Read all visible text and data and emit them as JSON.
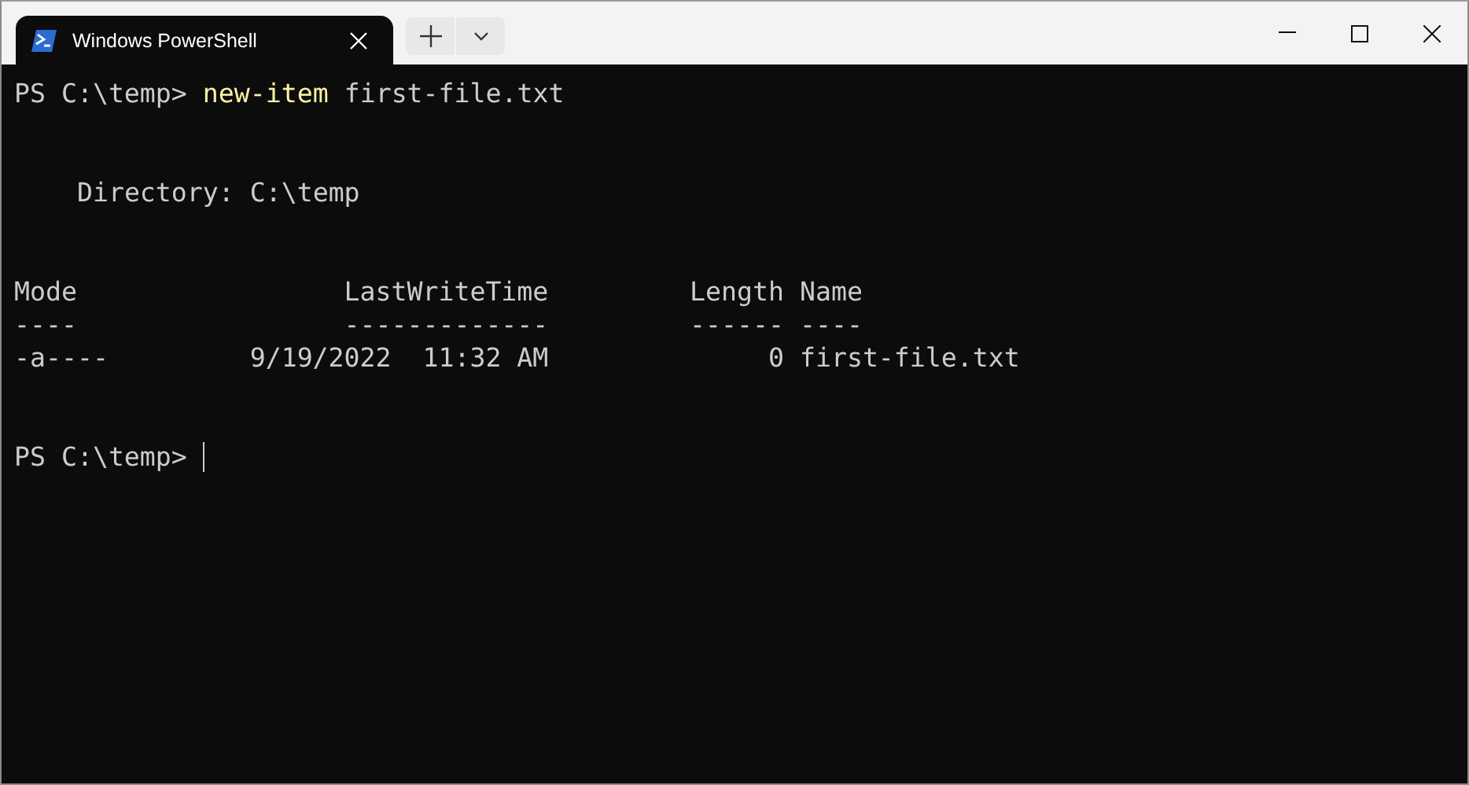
{
  "window": {
    "tab": {
      "title": "Windows PowerShell",
      "selected": true
    }
  },
  "terminal": {
    "command_line": {
      "prompt": "PS C:\\temp>",
      "command": "new-item",
      "argument": "first-file.txt"
    },
    "directory": "Directory: C:\\temp",
    "table": {
      "columns": [
        {
          "header": "Mode",
          "rule": "----"
        },
        {
          "header": "LastWriteTime",
          "rule": "-------------"
        },
        {
          "header": "Length",
          "rule": "------"
        },
        {
          "header": "Name",
          "rule": "----"
        }
      ],
      "rows": [
        [
          "-a----",
          "9/19/2022  11:32 AM",
          "0",
          "first-file.txt"
        ]
      ]
    },
    "prompt": "PS C:\\temp>"
  }
}
